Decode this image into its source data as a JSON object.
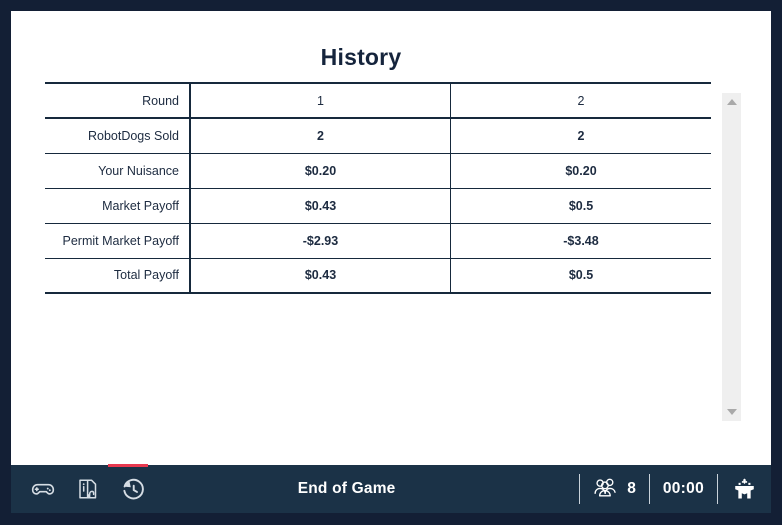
{
  "window": {
    "frame_color": "#131f35",
    "page_background": "#ffffff",
    "footer_color": "#1b3247",
    "accent_color": "#e8384f"
  },
  "page": {
    "title": "History"
  },
  "history_table": {
    "rows": [
      {
        "label": "Round",
        "values": [
          "1",
          "2"
        ]
      },
      {
        "label": "RobotDogs Sold",
        "values": [
          "2",
          "2"
        ]
      },
      {
        "label": "Your Nuisance",
        "values": [
          "$0.20",
          "$0.20"
        ]
      },
      {
        "label": "Market Payoff",
        "values": [
          "$0.43",
          "$0.5"
        ]
      },
      {
        "label": "Permit Market Payoff",
        "values": [
          "-$2.93",
          "-$3.48"
        ]
      },
      {
        "label": "Total Payoff",
        "values": [
          "$0.43",
          "$0.5"
        ]
      }
    ]
  },
  "scrollbar": {
    "up_icon": "triangle-up-icon",
    "down_icon": "triangle-down-icon"
  },
  "footer": {
    "nav": [
      {
        "icon": "gamepad-icon",
        "name": "game-tab",
        "active": false
      },
      {
        "icon": "instructions-icon",
        "name": "instructions-tab",
        "active": false
      },
      {
        "icon": "history-clock-icon",
        "name": "history-tab",
        "active": true
      }
    ],
    "status_text": "End of Game",
    "players_icon": "players-group-icon",
    "players_count": "8",
    "timer": "00:00",
    "brand_icon": "otree-logo-icon"
  }
}
